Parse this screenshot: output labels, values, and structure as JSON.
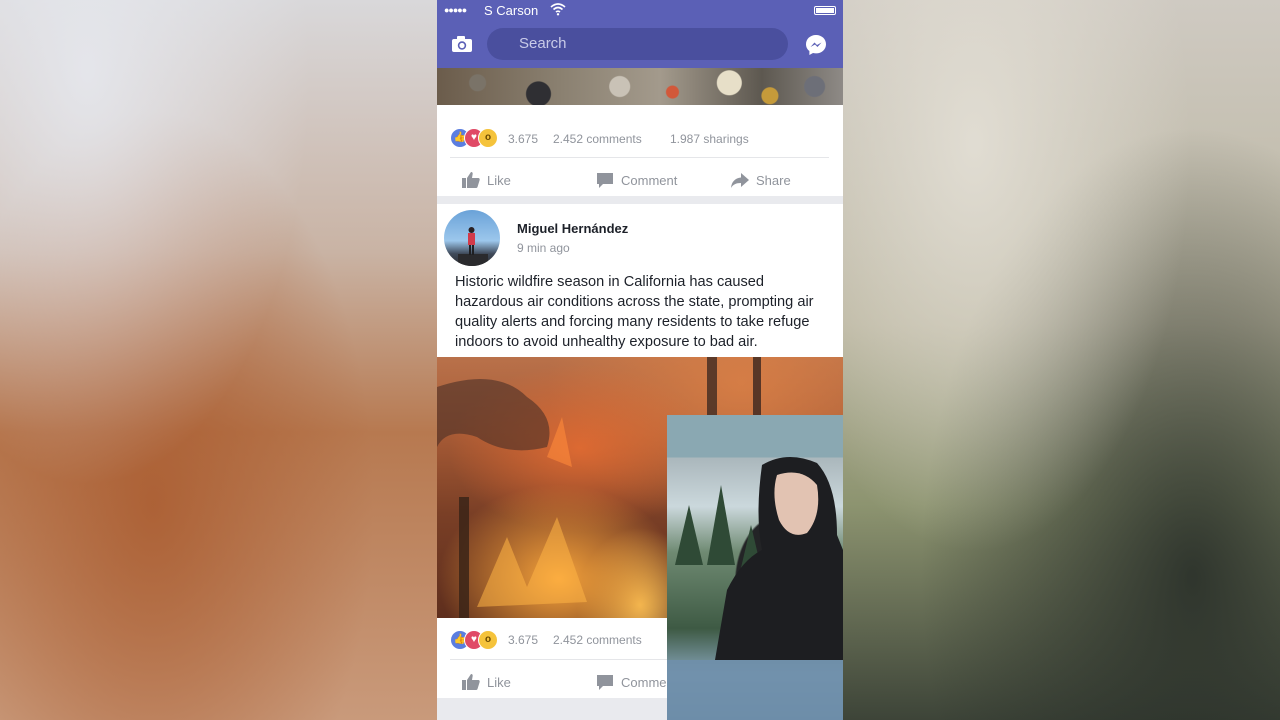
{
  "status_bar": {
    "signal": "●●●●●",
    "carrier": "S Carson"
  },
  "navbar": {
    "search_placeholder": "Search"
  },
  "post1": {
    "reaction_count": "3.675",
    "comments": "2.452 comments",
    "sharings": "1.987 sharings",
    "actions": {
      "like": "Like",
      "comment": "Comment",
      "share": "Share"
    }
  },
  "post2": {
    "author": "Miguel Hernández",
    "time": "9 min ago",
    "text": "Historic wildfire season in California has caused hazardous air conditions across the state, prompting air quality alerts and forcing many residents to take refuge indoors to avoid unhealthy exposure to bad air.",
    "reaction_count": "3.675",
    "comments": "2.452 comments",
    "actions": {
      "like": "Like",
      "comment": "Comme"
    }
  },
  "colors": {
    "brand": "#5b60b6",
    "search_bg": "#4a4f9e",
    "meta": "#90949c"
  }
}
